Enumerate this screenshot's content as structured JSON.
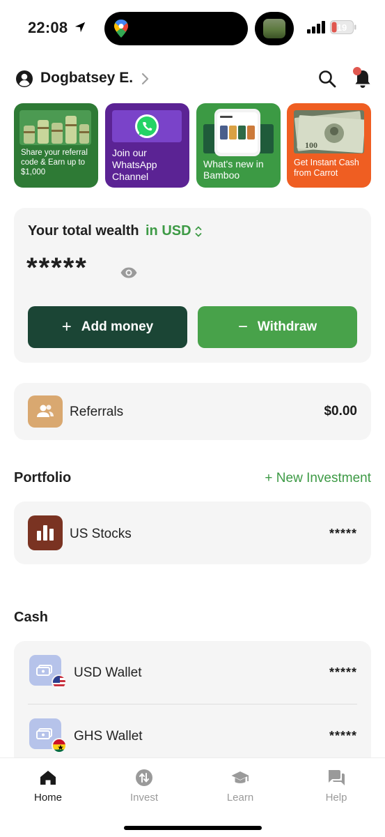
{
  "status_bar": {
    "time": "22:08",
    "battery": "19"
  },
  "header": {
    "username": "Dogbatsey E.",
    "icons": [
      "user-icon",
      "search-icon",
      "bell-icon"
    ]
  },
  "promos": [
    {
      "line1": "Share your referral",
      "line2": "code & Earn up to",
      "line3": "$1,000",
      "bg": "#2e7a35"
    },
    {
      "line1": "Join our",
      "line2": "WhatsApp",
      "line3": "Channel",
      "bg": "#5b2394"
    },
    {
      "line1": "What's new in",
      "line2": "Bamboo",
      "bg": "#3c9a44"
    },
    {
      "line1": "Get Instant Cash",
      "line2": "from Carrot",
      "bg": "#ef5e22"
    }
  ],
  "wealth": {
    "label": "Your total wealth",
    "currency": "in USD",
    "value": "*****",
    "add_label": "Add money",
    "withdraw_label": "Withdraw"
  },
  "referrals": {
    "label": "Referrals",
    "amount": "$0.00"
  },
  "portfolio": {
    "title": "Portfolio",
    "new_investment": "+ New Investment",
    "items": [
      {
        "label": "US Stocks",
        "value": "*****"
      }
    ]
  },
  "cash": {
    "title": "Cash",
    "wallets": [
      {
        "label": "USD Wallet",
        "value": "*****"
      },
      {
        "label": "GHS Wallet",
        "value": "*****"
      }
    ]
  },
  "nav": [
    {
      "label": "Home",
      "active": true
    },
    {
      "label": "Invest",
      "active": false
    },
    {
      "label": "Learn",
      "active": false
    },
    {
      "label": "Help",
      "active": false
    }
  ],
  "colors": {
    "accent_green": "#3d9a45",
    "dark_green": "#1b4535",
    "notification": "#e0574f"
  }
}
